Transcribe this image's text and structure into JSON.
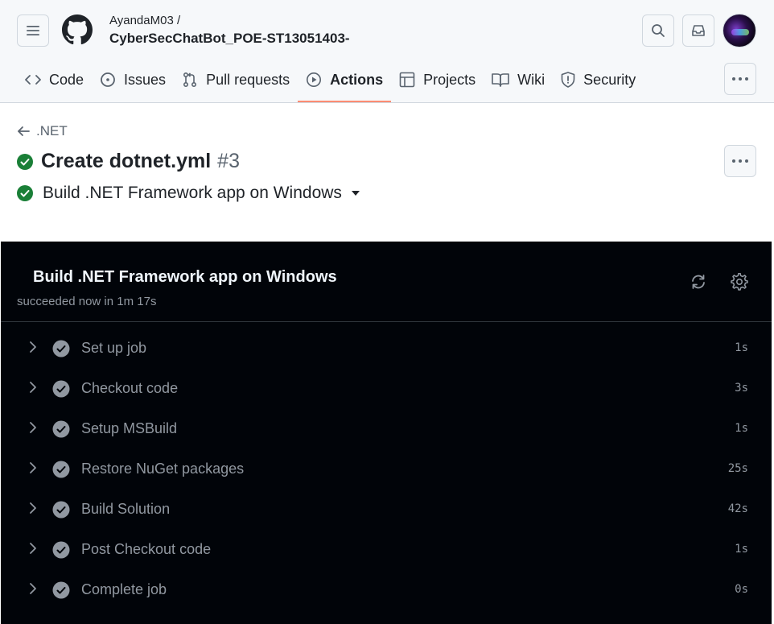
{
  "repo": {
    "owner": "AyandaM03 /",
    "name": "CyberSecChatBot_POE-ST13051403-"
  },
  "nav": {
    "tabs": [
      {
        "label": "Code",
        "icon": "code-icon"
      },
      {
        "label": "Issues",
        "icon": "issue-icon"
      },
      {
        "label": "Pull requests",
        "icon": "pull-request-icon"
      },
      {
        "label": "Actions",
        "icon": "play-icon"
      },
      {
        "label": "Projects",
        "icon": "table-icon"
      },
      {
        "label": "Wiki",
        "icon": "book-icon"
      },
      {
        "label": "Security",
        "icon": "shield-icon"
      }
    ],
    "active": "Actions"
  },
  "run": {
    "back_label": ".NET",
    "title": "Create dotnet.yml",
    "number": "#3",
    "job_selected": "Build .NET Framework app on Windows"
  },
  "log": {
    "title": "Build .NET Framework app on Windows",
    "status": "succeeded now in 1m 17s",
    "steps": [
      {
        "name": "Set up job",
        "duration": "1s"
      },
      {
        "name": "Checkout code",
        "duration": "3s"
      },
      {
        "name": "Setup MSBuild",
        "duration": "1s"
      },
      {
        "name": "Restore NuGet packages",
        "duration": "25s"
      },
      {
        "name": "Build Solution",
        "duration": "42s"
      },
      {
        "name": "Post Checkout code",
        "duration": "1s"
      },
      {
        "name": "Complete job",
        "duration": "0s"
      }
    ]
  },
  "colors": {
    "success": "#1a7f37",
    "tab_underline": "#fd8c73",
    "log_bg": "#010409"
  }
}
